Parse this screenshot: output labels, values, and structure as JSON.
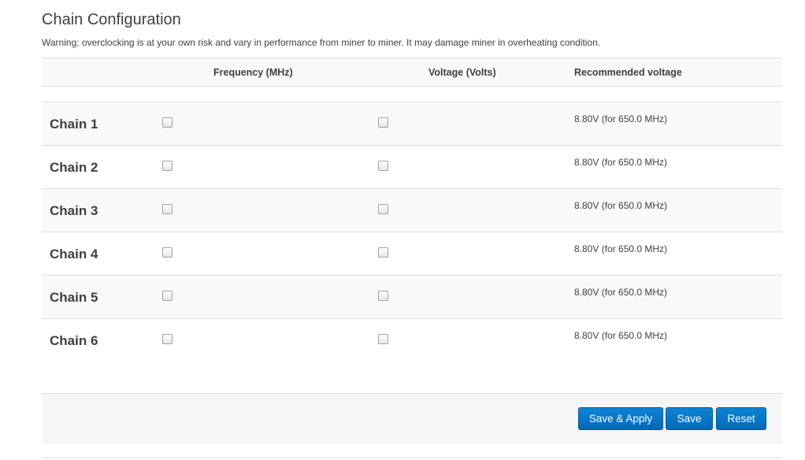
{
  "section": {
    "title": "Chain Configuration",
    "warning": "Warning: overclocking is at your own risk and vary in performance from miner to miner. It may damage miner in overheating condition."
  },
  "table": {
    "headers": {
      "frequency": "Frequency (MHz)",
      "voltage": "Voltage (Volts)",
      "recommended": "Recommended voltage"
    },
    "rows": [
      {
        "name": "Chain 1",
        "recommended": "8.80V (for 650.0 MHz)",
        "frequency_checked": false,
        "voltage_checked": false
      },
      {
        "name": "Chain 2",
        "recommended": "8.80V (for 650.0 MHz)",
        "frequency_checked": false,
        "voltage_checked": false
      },
      {
        "name": "Chain 3",
        "recommended": "8.80V (for 650.0 MHz)",
        "frequency_checked": false,
        "voltage_checked": false
      },
      {
        "name": "Chain 4",
        "recommended": "8.80V (for 650.0 MHz)",
        "frequency_checked": false,
        "voltage_checked": false
      },
      {
        "name": "Chain 5",
        "recommended": "8.80V (for 650.0 MHz)",
        "frequency_checked": false,
        "voltage_checked": false
      },
      {
        "name": "Chain 6",
        "recommended": "8.80V (for 650.0 MHz)",
        "frequency_checked": false,
        "voltage_checked": false
      }
    ]
  },
  "actions": {
    "save_apply_label": "Save & Apply",
    "save_label": "Save",
    "reset_label": "Reset"
  },
  "colors": {
    "button_primary": "#0068b8",
    "row_stripe": "#f9f9f9",
    "text": "#404040"
  }
}
